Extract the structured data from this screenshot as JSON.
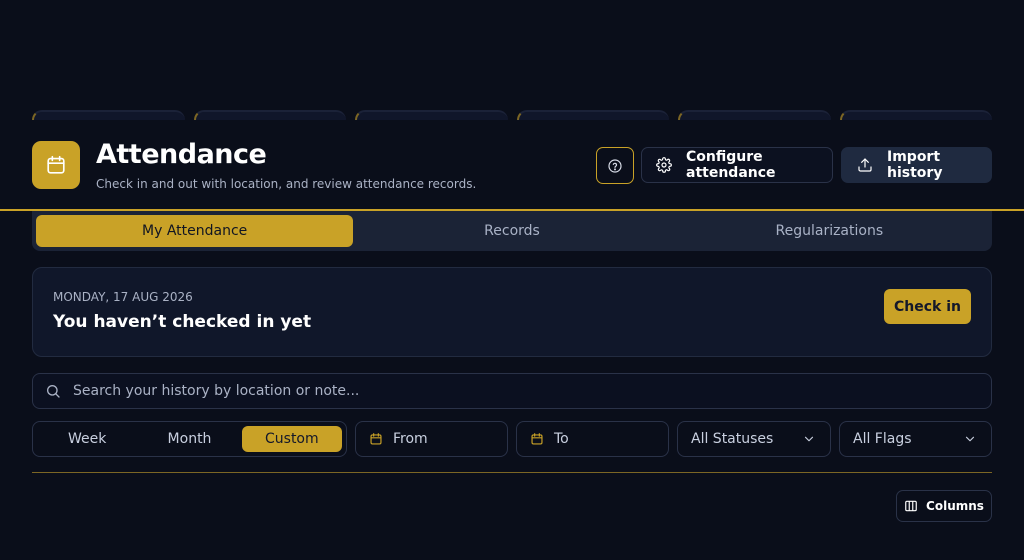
{
  "header": {
    "title": "Attendance",
    "subtitle": "Check in and out with location, and review attendance records.",
    "configure_label": "Configure attendance",
    "import_label": "Import history"
  },
  "tabs": [
    {
      "label": "My Attendance",
      "active": true
    },
    {
      "label": "Records",
      "active": false
    },
    {
      "label": "Regularizations",
      "active": false
    }
  ],
  "status": {
    "date": "MONDAY, 17 AUG 2026",
    "message": "You haven’t checked in yet",
    "check_in_label": "Check in"
  },
  "search": {
    "placeholder": "Search your history by location or note..."
  },
  "filters": {
    "range": [
      {
        "label": "Week",
        "active": false
      },
      {
        "label": "Month",
        "active": false
      },
      {
        "label": "Custom",
        "active": true
      }
    ],
    "from_label": "From",
    "to_label": "To",
    "status_select": "All Statuses",
    "flags_select": "All Flags"
  },
  "columns_label": "Columns",
  "colors": {
    "accent": "#c9a227",
    "background": "#0a0e1a",
    "card": "#10172a"
  },
  "icons": [
    "calendar-icon",
    "help-icon",
    "gear-icon",
    "upload-icon",
    "search-icon",
    "chevron-down-icon",
    "columns-icon"
  ]
}
